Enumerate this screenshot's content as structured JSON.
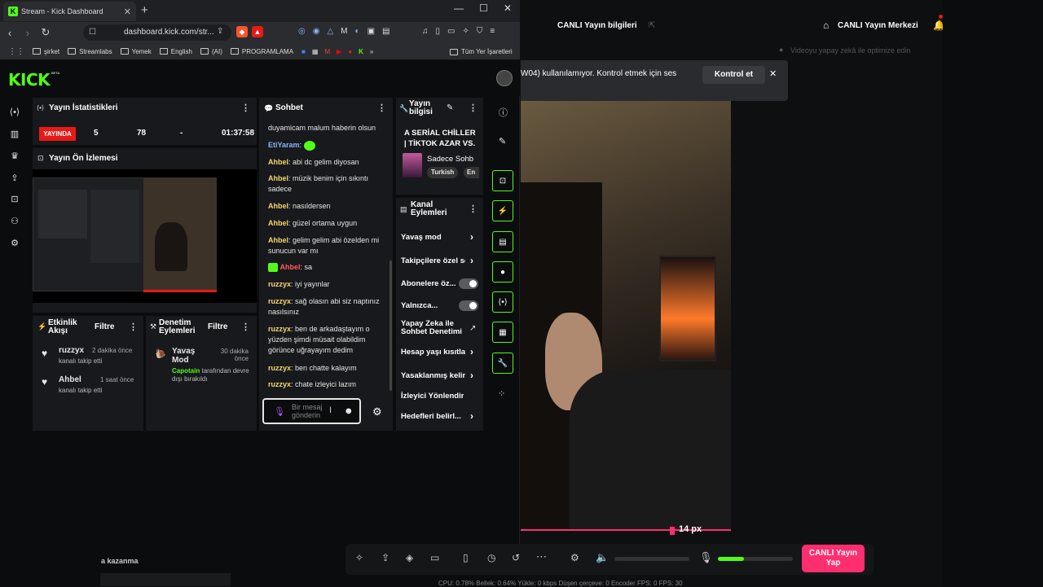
{
  "browser": {
    "tab_title": "Stream - Kick Dashboard",
    "url": "dashboard.kick.com/str...",
    "bookmarks": [
      "şirket",
      "Streamlabs",
      "Yemek",
      "English",
      "(AI)",
      "PROGRAMLAMA"
    ],
    "all_bookmarks": "Tüm Yer İşaretleri"
  },
  "kick": {
    "logo": "KICK",
    "beta": "BETA"
  },
  "stats": {
    "title": "Yayın İstatistikleri",
    "live_label": "YAYINDA",
    "viewers": "5",
    "followers": "78",
    "subs": "-",
    "duration": "01:37:58"
  },
  "preview": {
    "title": "Yayın Ön İzlemesi"
  },
  "activity": {
    "title": "Etkinlik Akışı",
    "filter": "Filtre",
    "items": [
      {
        "user": "ruzzyx",
        "time": "2 dakika önce",
        "desc": "kanalı takip etti"
      },
      {
        "user": "Ahbel",
        "time": "1 saat önce",
        "desc": "kanalı takip etti"
      }
    ]
  },
  "moderation": {
    "title": "Denetim Eylemleri",
    "filter": "Filtre",
    "item": {
      "title": "Yavaş Mod",
      "time": "30 dakika önce",
      "actor": "Capotain",
      "desc": "tarafından devre dışı bırakıldı"
    }
  },
  "chat": {
    "title": "Sohbet",
    "top_text": "duyamicam malum haberin olsun",
    "messages": [
      {
        "user": "EtiYaram",
        "text": "",
        "color": "#8ab4f8"
      },
      {
        "user": "Ahbel",
        "text": "abi dc gelim diyosan",
        "color": "#f5d76e"
      },
      {
        "user": "Ahbel",
        "text": "müzik benim için sıkıntı sadece",
        "color": "#f5d76e"
      },
      {
        "user": "Ahbel",
        "text": "nasıldersen",
        "color": "#f5d76e"
      },
      {
        "user": "Ahbel",
        "text": "güzel ortama uygun",
        "color": "#f5d76e"
      },
      {
        "user": "Ahbel",
        "text": "gelim gelim abi özelden mi sunucun var mı",
        "color": "#f5d76e"
      },
      {
        "user": "Ahbel",
        "text": "sa",
        "color": "#ff5a5a"
      },
      {
        "user": "ruzzyx",
        "text": "iyi yayınlar",
        "color": "#f5d76e"
      },
      {
        "user": "ruzzyx",
        "text": "sağ olasın abi siz naptınız nasılsınız",
        "color": "#f5d76e"
      },
      {
        "user": "ruzzyx",
        "text": "ben de arkadaştayım o yüzden şimdi müsait olabildim görünce uğrayayım dedim",
        "color": "#f5d76e"
      },
      {
        "user": "ruzzyx",
        "text": "ben chatte kalayım",
        "color": "#f5d76e"
      },
      {
        "user": "ruzzyx",
        "text": "chate izleyici lazım",
        "color": "#f5d76e"
      }
    ],
    "placeholder": "Bir mesaj gönderin"
  },
  "stream_info": {
    "title": "Yayın bilgisi",
    "stream_title": "A SERİAL CHİLLER | TİKTOK AZAR VS.",
    "category": "Sadece Sohb",
    "tags": [
      "Turkish",
      "En"
    ]
  },
  "channel_actions": {
    "title": "Kanal Eylemleri",
    "items": [
      "Yavaş mod",
      "Takipçilere özel sohbet",
      "Abonelere öz...",
      "Yalnızca...",
      "Yapay Zeka ile Sohbet Denetimi",
      "Hesap yaşı kısıtla",
      "Yasaklanmış kelime",
      "İzleyici Yönlendir",
      "Hedefleri belirl..."
    ]
  },
  "studio": {
    "live_info": "CANLI Yayın bilgileri",
    "live_center": "CANLI Yayın Merkezi",
    "optimize": "Videoyu yapay zekâ ile optimize edin",
    "banner_text": "W04) kullanılamıyor. Kontrol etmek için ses",
    "check": "Kontrol et",
    "px_label": "14 px",
    "go_live": "CANLI Yayın Yap",
    "kazanma": "a kazanma",
    "status": "CPU: 0.78%   Bellek: 0.64%   Yükle: 0 kbps   Düşen çerçeve: 0   Encoder FPS: 0   FPS: 30"
  }
}
